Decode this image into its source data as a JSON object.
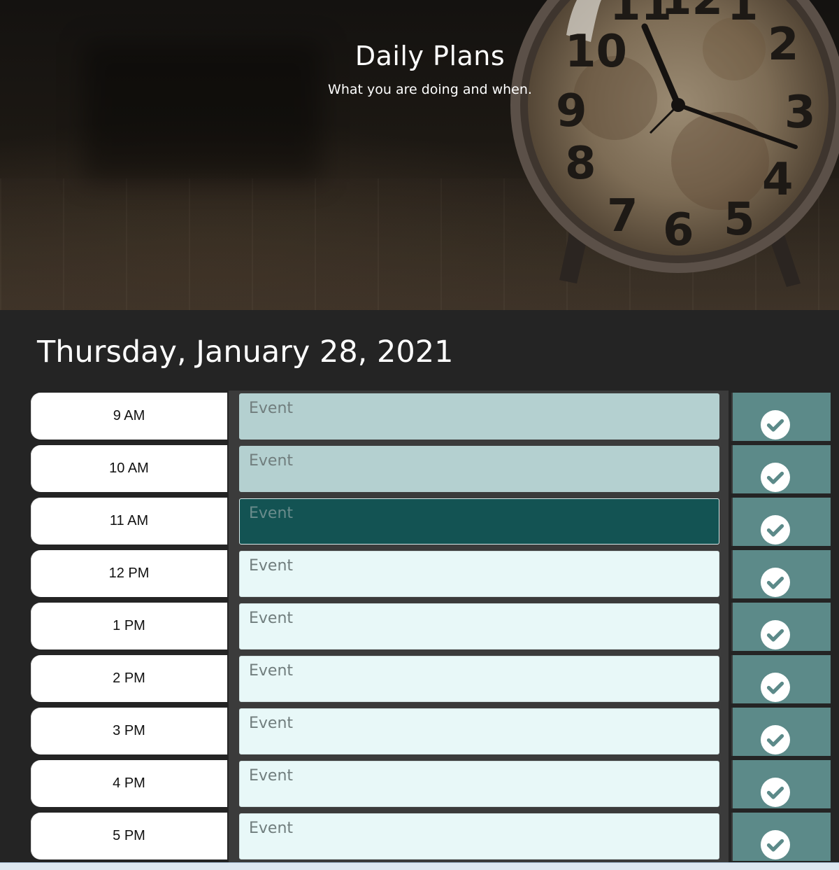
{
  "header": {
    "title": "Daily Plans",
    "subtitle": "What you are doing and when."
  },
  "current_date": "Thursday, January 28, 2021",
  "event_placeholder": "Event",
  "timeblocks": [
    {
      "hour": "9 AM",
      "status": "past",
      "value": ""
    },
    {
      "hour": "10 AM",
      "status": "past",
      "value": ""
    },
    {
      "hour": "11 AM",
      "status": "present",
      "value": ""
    },
    {
      "hour": "12 PM",
      "status": "future",
      "value": ""
    },
    {
      "hour": "1 PM",
      "status": "future",
      "value": ""
    },
    {
      "hour": "2 PM",
      "status": "future",
      "value": ""
    },
    {
      "hour": "3 PM",
      "status": "future",
      "value": ""
    },
    {
      "hour": "4 PM",
      "status": "future",
      "value": ""
    },
    {
      "hour": "5 PM",
      "status": "future",
      "value": ""
    }
  ],
  "save_icon": "check-circle-icon",
  "colors": {
    "past": "#b4d0d0",
    "present": "#135353",
    "future": "#e8f8f8",
    "save": "#5c8a89",
    "background": "#242424"
  }
}
